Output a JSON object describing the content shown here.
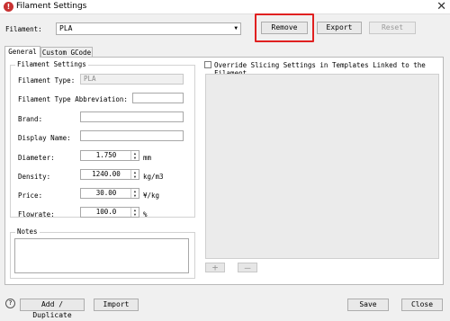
{
  "window": {
    "title": "Filament Settings",
    "close_glyph": "✕",
    "app_icon_glyph": "!"
  },
  "header": {
    "filament_label": "Filament:",
    "filament_value": "PLA",
    "remove_label": "Remove",
    "export_label": "Export",
    "reset_label": "Reset"
  },
  "tabs": [
    "General",
    "Custom GCode"
  ],
  "settings": {
    "group_title": "Filament Settings",
    "type_label": "Filament Type:",
    "type_value": "PLA",
    "abbrev_label": "Filament Type Abbreviation:",
    "abbrev_value": "",
    "brand_label": "Brand:",
    "brand_value": "",
    "display_name_label": "Display Name:",
    "display_name_value": "",
    "diameter_label": "Diameter:",
    "diameter_value": "1.750",
    "diameter_unit": "mm",
    "density_label": "Density:",
    "density_value": "1240.00",
    "density_unit": "kg/m3",
    "price_label": "Price:",
    "price_value": "30.00",
    "price_unit": "¥/kg",
    "flowrate_label": "Flowrate:",
    "flowrate_value": "100.0",
    "flowrate_unit": "%"
  },
  "notes": {
    "title": "Notes",
    "value": ""
  },
  "override": {
    "label": "Override Slicing Settings in Templates Linked to the Filament",
    "checked": false
  },
  "list_buttons": {
    "add": "+",
    "remove": "—"
  },
  "footer": {
    "help": "?",
    "add_duplicate_label": "Add / Duplicate",
    "import_label": "Import",
    "save_label": "Save",
    "close_label": "Close"
  },
  "colors": {
    "highlight": "#e02020",
    "app_icon": "#c83232"
  }
}
